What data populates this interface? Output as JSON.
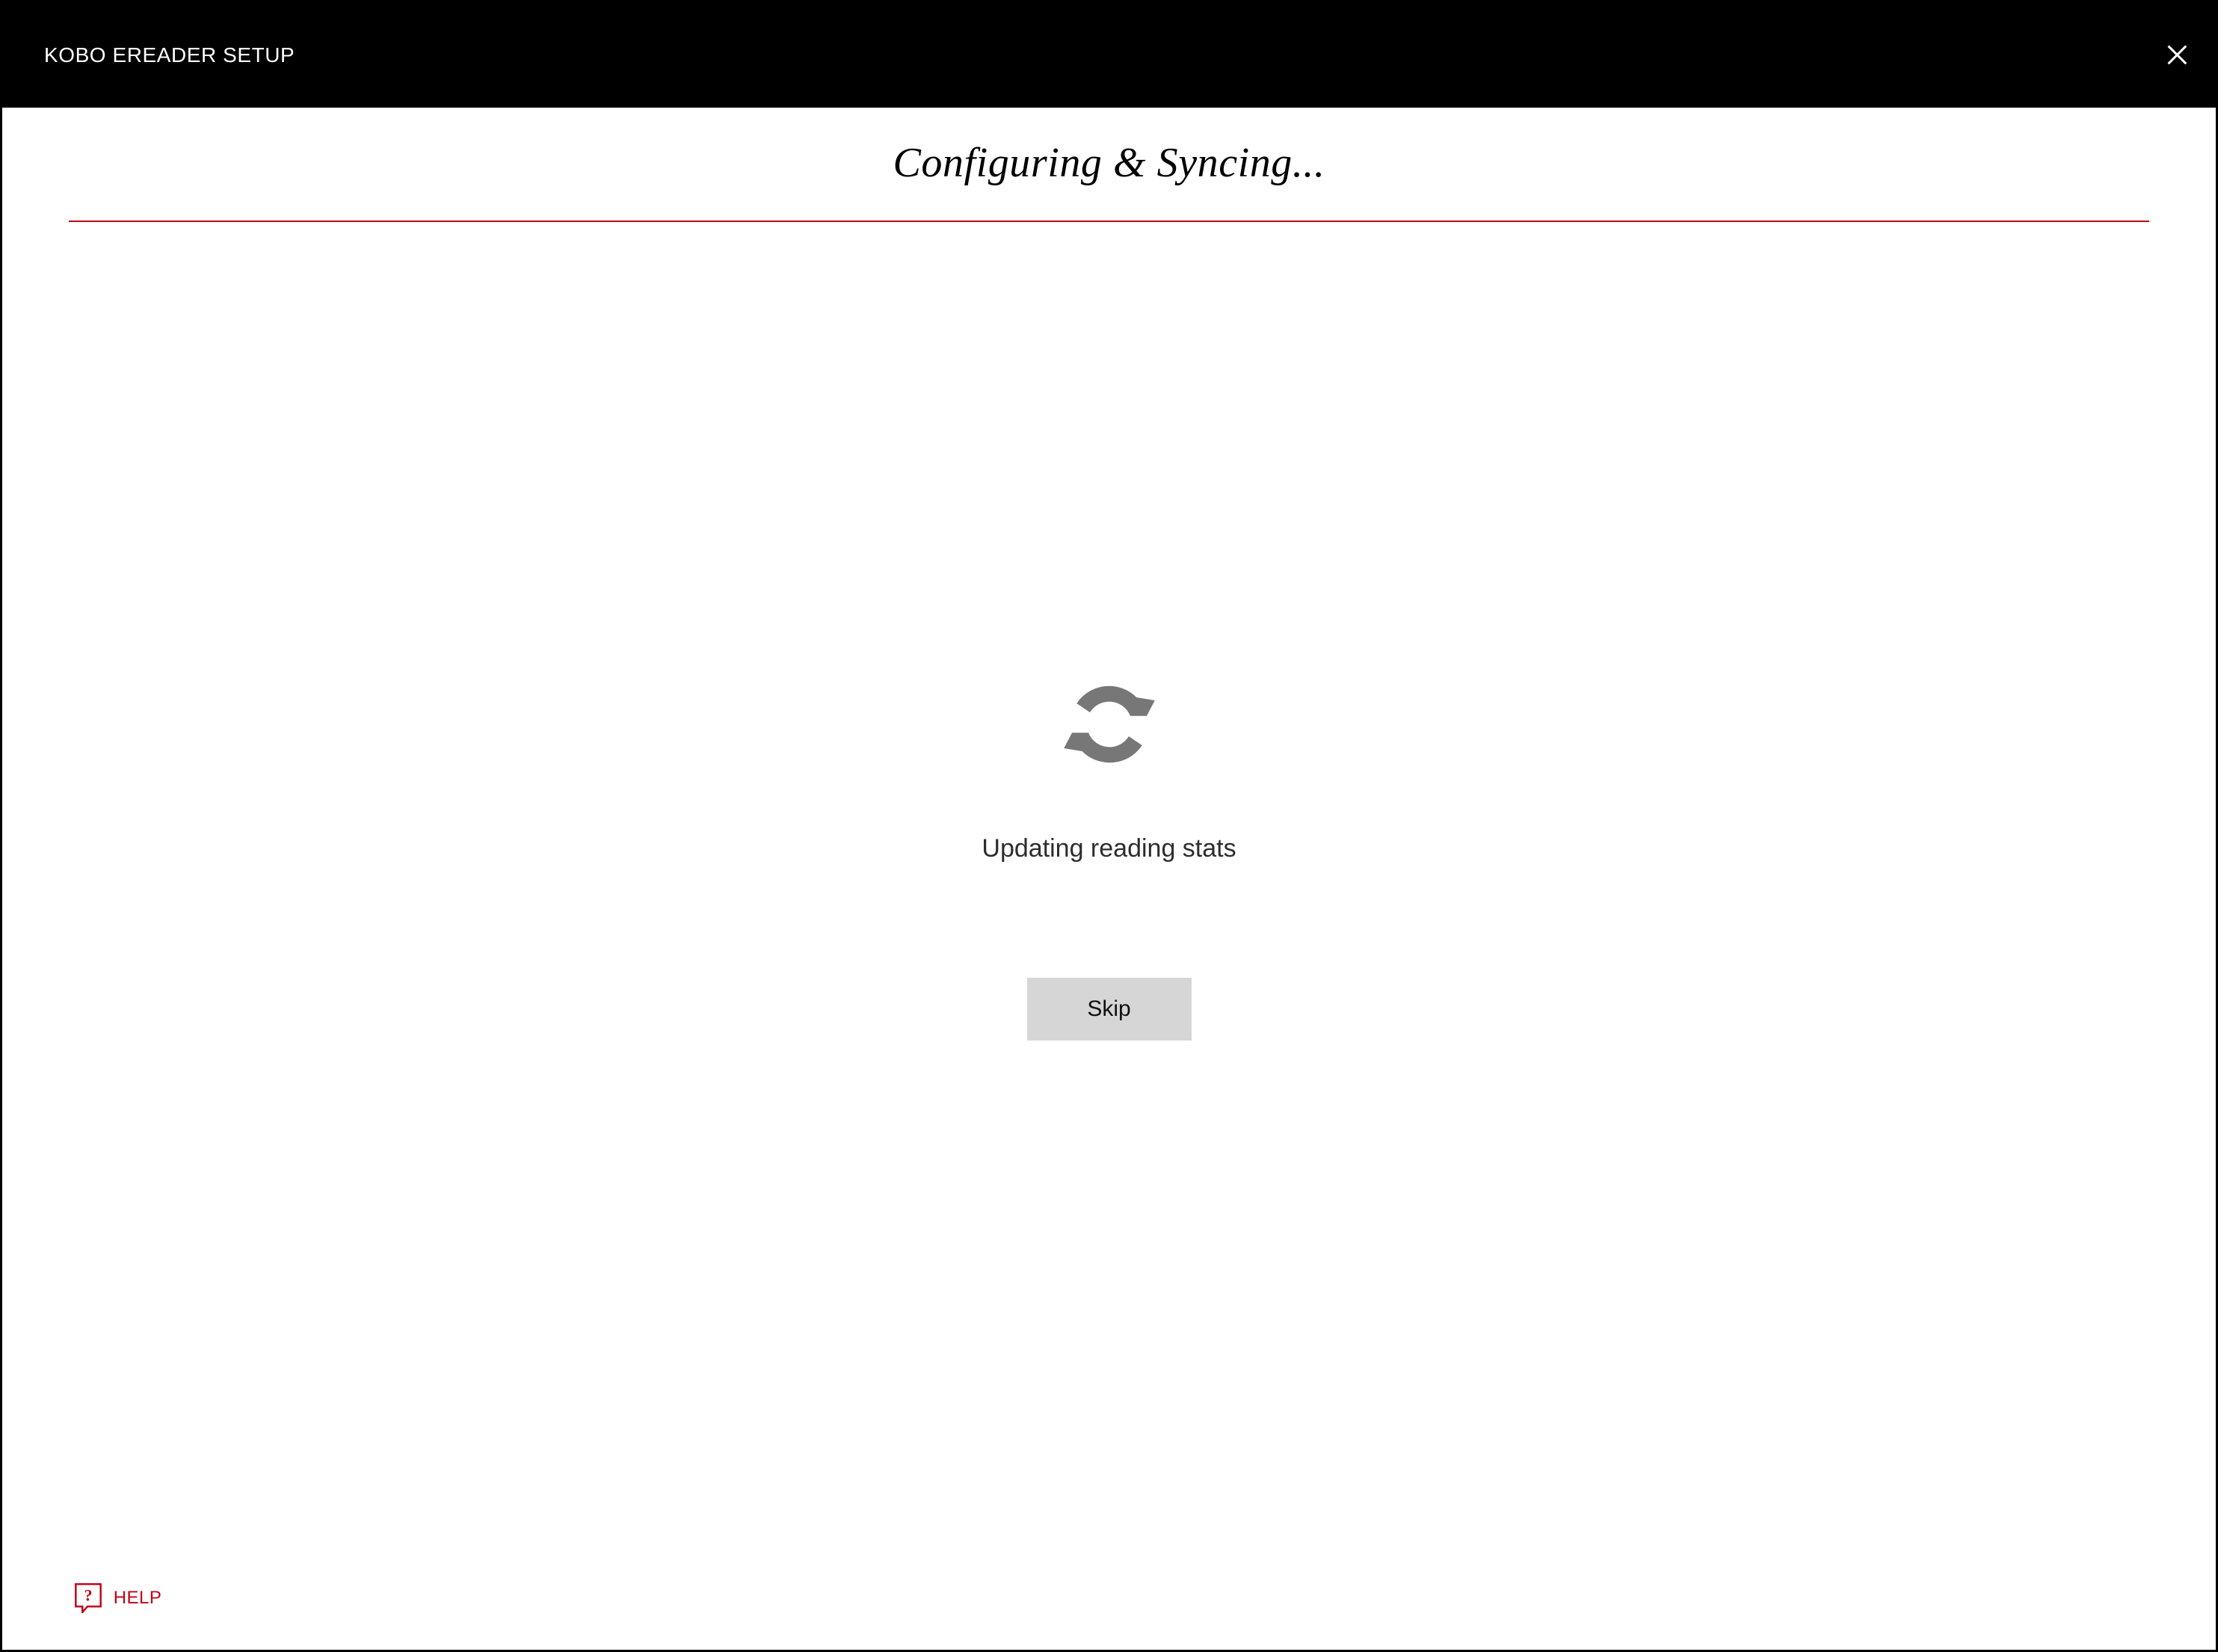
{
  "titlebar": {
    "title": "KOBO EREADER SETUP"
  },
  "heading": "Configuring & Syncing...",
  "status": "Updating reading stats",
  "buttons": {
    "skip": "Skip"
  },
  "help": {
    "label": "HELP"
  },
  "colors": {
    "accent": "#c00018",
    "titlebar_bg": "#000000",
    "button_bg": "#d6d6d6",
    "sync_icon": "#777777"
  }
}
